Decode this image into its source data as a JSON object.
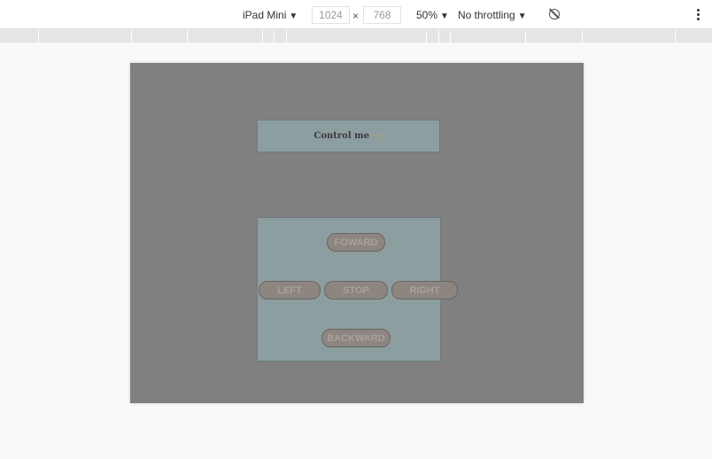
{
  "toolbar": {
    "device": "iPad Mini",
    "width": "1024",
    "times": "×",
    "height": "768",
    "zoom": "50%",
    "throttling": "No throttling",
    "caret": "▼"
  },
  "icons": {
    "rotate": "rotate-icon",
    "more": "more-vert-icon",
    "star": "star-icon"
  },
  "app": {
    "title": "Control me",
    "star": "☆",
    "buttons": {
      "forward": "FOWARD",
      "left": "LEFT",
      "stop": "STOP",
      "right": "RIGHT",
      "backward": "BACKWARD"
    }
  },
  "colors": {
    "overlay": "#808080",
    "panel": "#8c9ea0",
    "button": "#8c8580",
    "button_text": "#a9a19b"
  }
}
